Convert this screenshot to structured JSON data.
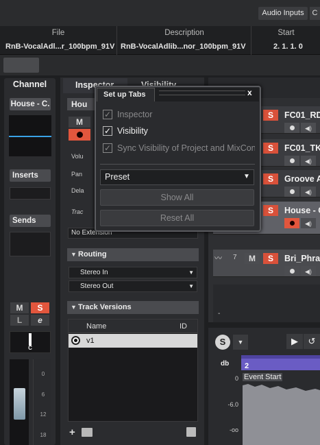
{
  "topbar": {
    "audio_inputs": "Audio Inputs",
    "c_label": "C"
  },
  "infoline": {
    "file_header": "File",
    "file_value": "RnB-VocalAdl...r_100bpm_91V",
    "description_header": "Description",
    "description_value": "RnB-VocalAdlib...nor_100bpm_91V",
    "start_header": "Start",
    "start_value": "2. 1. 1.   0"
  },
  "channel": {
    "title": "Channel",
    "name": "House - C.",
    "inserts": "Inserts",
    "sends": "Sends",
    "m": "M",
    "s": "S",
    "l": "L",
    "e": "e",
    "pan": "C",
    "scale": [
      "0",
      "6",
      "12",
      "18"
    ]
  },
  "inspector": {
    "tab_inspector": "Inspector",
    "tab_visibility": "Visibility",
    "section_house": "Hou",
    "m": "M",
    "rows": [
      "Volu",
      "Pan",
      "Dela"
    ],
    "track_row": "Trac",
    "no_extension": "No Extension",
    "routing": "Routing",
    "stereo_in": "Stereo In",
    "stereo_out": "Stereo Out",
    "track_versions": "Track Versions",
    "tv_columns": {
      "name": "Name",
      "id": "ID"
    },
    "tv_rows": [
      {
        "name": "v1",
        "id": ""
      }
    ]
  },
  "dialog": {
    "title": "Set up Tabs",
    "close": "x",
    "options": [
      {
        "label": "Inspector",
        "checked": true,
        "enabled": false
      },
      {
        "label": "Visibility",
        "checked": true,
        "enabled": true
      },
      {
        "label": "Sync Visibility of Project and MixCon",
        "checked": true,
        "enabled": false
      }
    ],
    "preset": "Preset",
    "show_all": "Show All",
    "reset_all": "Reset All"
  },
  "tracks": [
    {
      "name": "FC01_RD",
      "m": "",
      "s": "S",
      "selected": false,
      "recording": false
    },
    {
      "name": "FC01_TK",
      "m": "",
      "s": "S",
      "selected": false,
      "recording": false
    },
    {
      "name": "Groove A",
      "m": "",
      "s": "S",
      "selected": false,
      "recording": false
    },
    {
      "name": "House - C",
      "m": "",
      "s": "S",
      "selected": true,
      "recording": true
    },
    {
      "name": "Bri_Phras",
      "m": "M",
      "s": "S",
      "selected": false,
      "recording": false,
      "number": "7"
    }
  ],
  "tracklist": {
    "dash": "-"
  },
  "editor": {
    "s_label": "S",
    "db_label": "db",
    "ruler_mark": "2",
    "event_start": "Event Start",
    "db_scale": [
      "0",
      "-6.0",
      "-oo"
    ]
  },
  "colors": {
    "solo": "#d9513a",
    "record": "#e2563d",
    "meter_line": "#3aa2e6",
    "ruler": "#6a5cc4"
  }
}
